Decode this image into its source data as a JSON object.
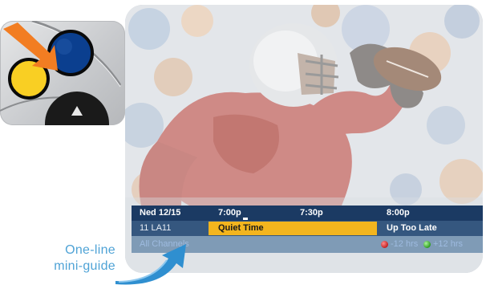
{
  "guide": {
    "date": "Ned 12/15",
    "times": [
      "7:00p",
      "7:30p",
      "8:00p"
    ],
    "channel": "11 LA11",
    "current_program": "Quiet Time",
    "next_program": "Up Too Late",
    "filter": "All Channels",
    "back_hint": "-12 hrs",
    "forward_hint": "+12 hrs"
  },
  "callout": {
    "line1": "One-line",
    "line2": "mini-guide"
  },
  "remote": {
    "buttons": [
      "blue-button",
      "yellow-button",
      "up-arrow-button"
    ]
  },
  "colors": {
    "accent_blue": "#0b3f8f",
    "yellow": "#f9cf23",
    "arrow_orange": "#f27d22",
    "callout_blue": "#4fa3d6"
  }
}
